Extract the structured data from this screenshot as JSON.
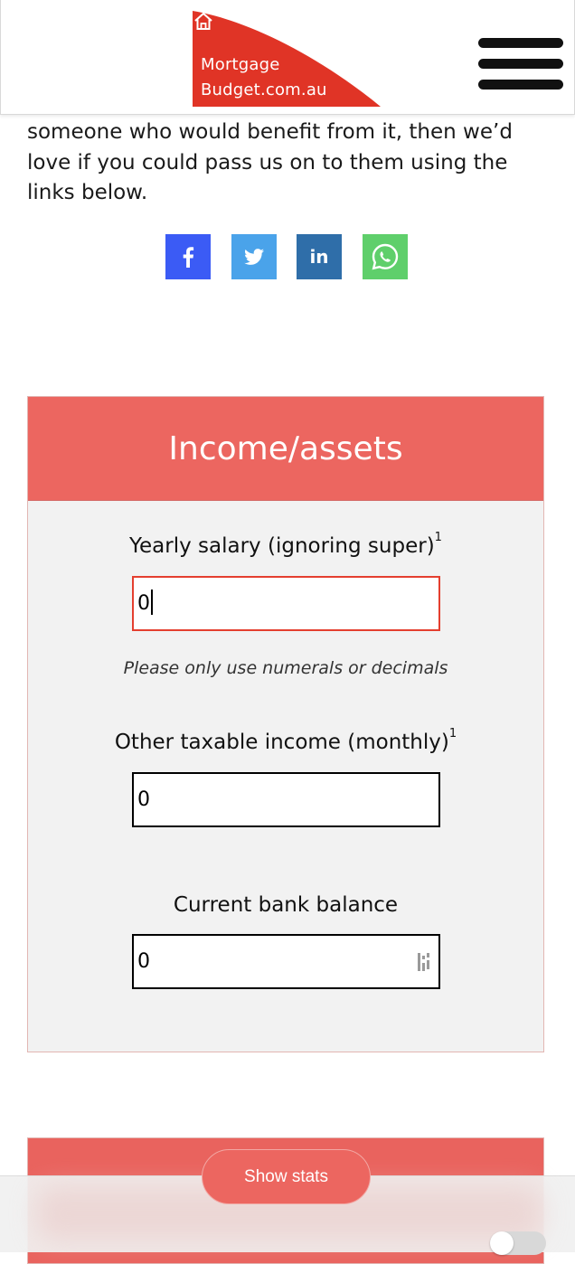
{
  "header": {
    "logo_line1": "Mortgage",
    "logo_line2": "Budget.com.au",
    "logo_color": "#e03426",
    "menu_icon": "hamburger-menu-icon"
  },
  "intro": {
    "text": "someone who would benefit from it, then we’d love if you could pass us on to them using the links below."
  },
  "share": [
    {
      "name": "facebook",
      "icon": "facebook-icon",
      "color": "#3b5bf5"
    },
    {
      "name": "twitter",
      "icon": "twitter-icon",
      "color": "#4aa3ea"
    },
    {
      "name": "linkedin",
      "icon": "linkedin-icon",
      "color": "#2f6ea9"
    },
    {
      "name": "whatsapp",
      "icon": "whatsapp-icon",
      "color": "#5fcf6b"
    }
  ],
  "income_card": {
    "title": "Income/assets",
    "header_color": "#ec6660",
    "fields": [
      {
        "label": "Yearly salary (ignoring super)",
        "sup": "1",
        "value": "0",
        "hint": "Please only use numerals or decimals"
      },
      {
        "label": "Other taxable income (monthly)",
        "sup": "1",
        "value": "0"
      },
      {
        "label": "Current bank balance",
        "value": "0"
      }
    ]
  },
  "footer": {
    "show_stats_label": "Show stats"
  }
}
